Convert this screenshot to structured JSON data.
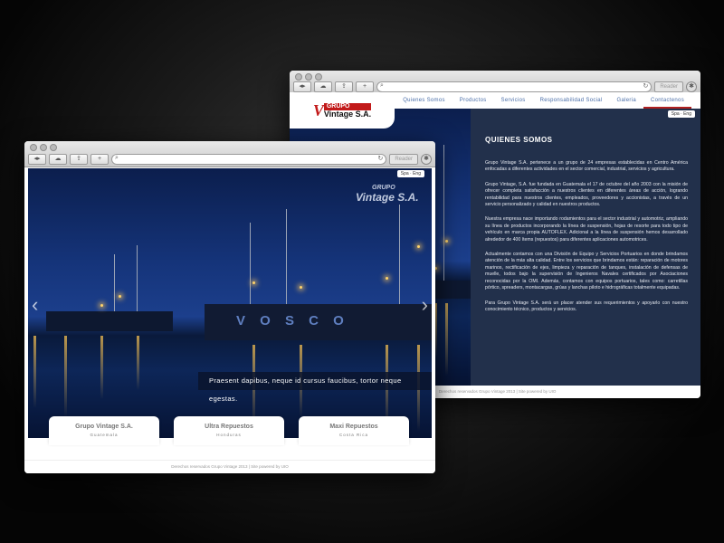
{
  "browser": {
    "reader_label": "Reader",
    "nav_back": "◂",
    "nav_forward": "▸",
    "search_glyph": "⌕",
    "reload_glyph": "↻",
    "gear_glyph": "✱"
  },
  "back_window": {
    "logo": {
      "mark": "V",
      "line1": "GRUPO",
      "line2": "Vintage S.A."
    },
    "nav": [
      {
        "label": "Quienes Somos"
      },
      {
        "label": "Productos"
      },
      {
        "label": "Servicios"
      },
      {
        "label": "Responsabilidad Social"
      },
      {
        "label": "Galeria"
      },
      {
        "label": "Contactenos",
        "active": true
      }
    ],
    "lang": "Spa · Eng",
    "heading": "QUIENES SOMOS",
    "paragraphs": [
      "Grupo Vintage S.A. pertenece a un grupo de 24 empresas establecidas en Centro América enfocadas a diferentes actividades en el sector comercial, industrial, servicios y agricultura.",
      "Grupo Vintage, S.A. fue fundada en Guatemala el 17 de octubre del año 2003 con la misión de ofrecer completa satisfacción a nuestros clientes en diferentes áreas de acción, logrando rentabilidad para nuestros clientes, empleados, proveedores y accionistas, a través de un servicio personalizado y calidad en nuestros productos.",
      "Nuestra empresa nace importando rodamientos para el sector industrial y automotriz, ampliando su línea de productos incorporando la línea de suspensión, hojas de resorte para todo tipo de vehículo en marca propia AUTOFLEX. Adicional a la línea de suspensión hemos desarrollado alrededor de 400 ítems (repuestos) para diferentes aplicaciones automotrices.",
      "Actualmente contamos con una División de Equipo y Servicios Portuarios en donde brindamos atención de la más alta calidad. Entre los servicios que brindamos están: reparación de motores marinos, rectificación de ejes, limpieza y reparación de tanques, instalación de defensas de muelle, todos bajo la supervisión de Ingenieros Navales certificados por Asociaciones reconocidas por la OMI. Además, contamos con equipos portuarios, tales como: carretillas pórtico, spreaders, montacargas, grúas y lanchas piloto e hidrográficas totalmente equipadas.",
      "Para Grupo Vintage S.A. será un placer atender sus requerimientos y apoyarlo con nuestro conocimiento técnico, productos y servicios."
    ],
    "footer": "Derechos reservados Grupo Vintage 2013  |  Site powered by UIO"
  },
  "front_window": {
    "lang": "Spa · Eng",
    "logo": {
      "line1": "GRUPO",
      "line2": "Vintage S.A."
    },
    "ship_text": "V O S C O",
    "caption": "Praesent dapibus, neque id cursus faucibus, tortor neque egestas.",
    "arrow_left": "‹",
    "arrow_right": "›",
    "cards": [
      {
        "name": "Grupo Vintage S.A.",
        "country": "Guatemala"
      },
      {
        "name": "Ultra Repuestos",
        "country": "Honduras"
      },
      {
        "name": "Maxi Repuestos",
        "country": "Costa Rica"
      }
    ],
    "footer": "Derechos reservados Grupo Vintage 2013  |  Site powered by UIO"
  },
  "colors": {
    "accent_red": "#c21a1a",
    "nav_blue": "#4a6ea8",
    "panel": "#0f1e3c"
  }
}
